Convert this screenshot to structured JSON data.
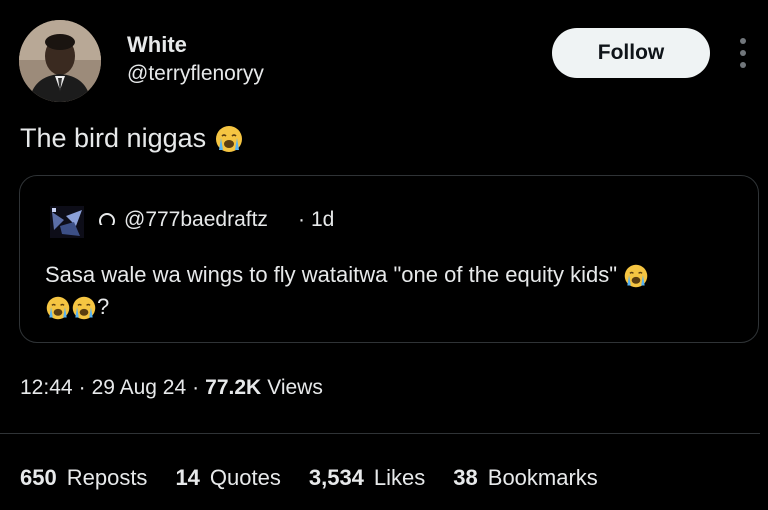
{
  "author": {
    "name": "White",
    "handle": "@terryflenoryy"
  },
  "follow_label": "Follow",
  "tweet": {
    "text": "The bird niggas",
    "emoji": "crying-face-emoji"
  },
  "quote": {
    "handle": "@777baedraftz",
    "separator": "·",
    "age": "1d",
    "text_line1": "Sasa wale wa wings to fly wataitwa \"one of the equity kids\"",
    "text_line2_suffix": "?"
  },
  "meta": {
    "time": "12:44",
    "sep1": "·",
    "date": "29 Aug 24",
    "sep2": "·",
    "views_count": "77.2K",
    "views_label": "Views"
  },
  "stats": {
    "reposts_count": "650",
    "reposts_label": "Reposts",
    "quotes_count": "14",
    "quotes_label": "Quotes",
    "likes_count": "3,534",
    "likes_label": "Likes",
    "bookmarks_count": "38",
    "bookmarks_label": "Bookmarks"
  },
  "colors": {
    "background": "#000000",
    "text": "#e7e9ea",
    "border": "#2f3336",
    "button_bg": "#eff3f4"
  }
}
